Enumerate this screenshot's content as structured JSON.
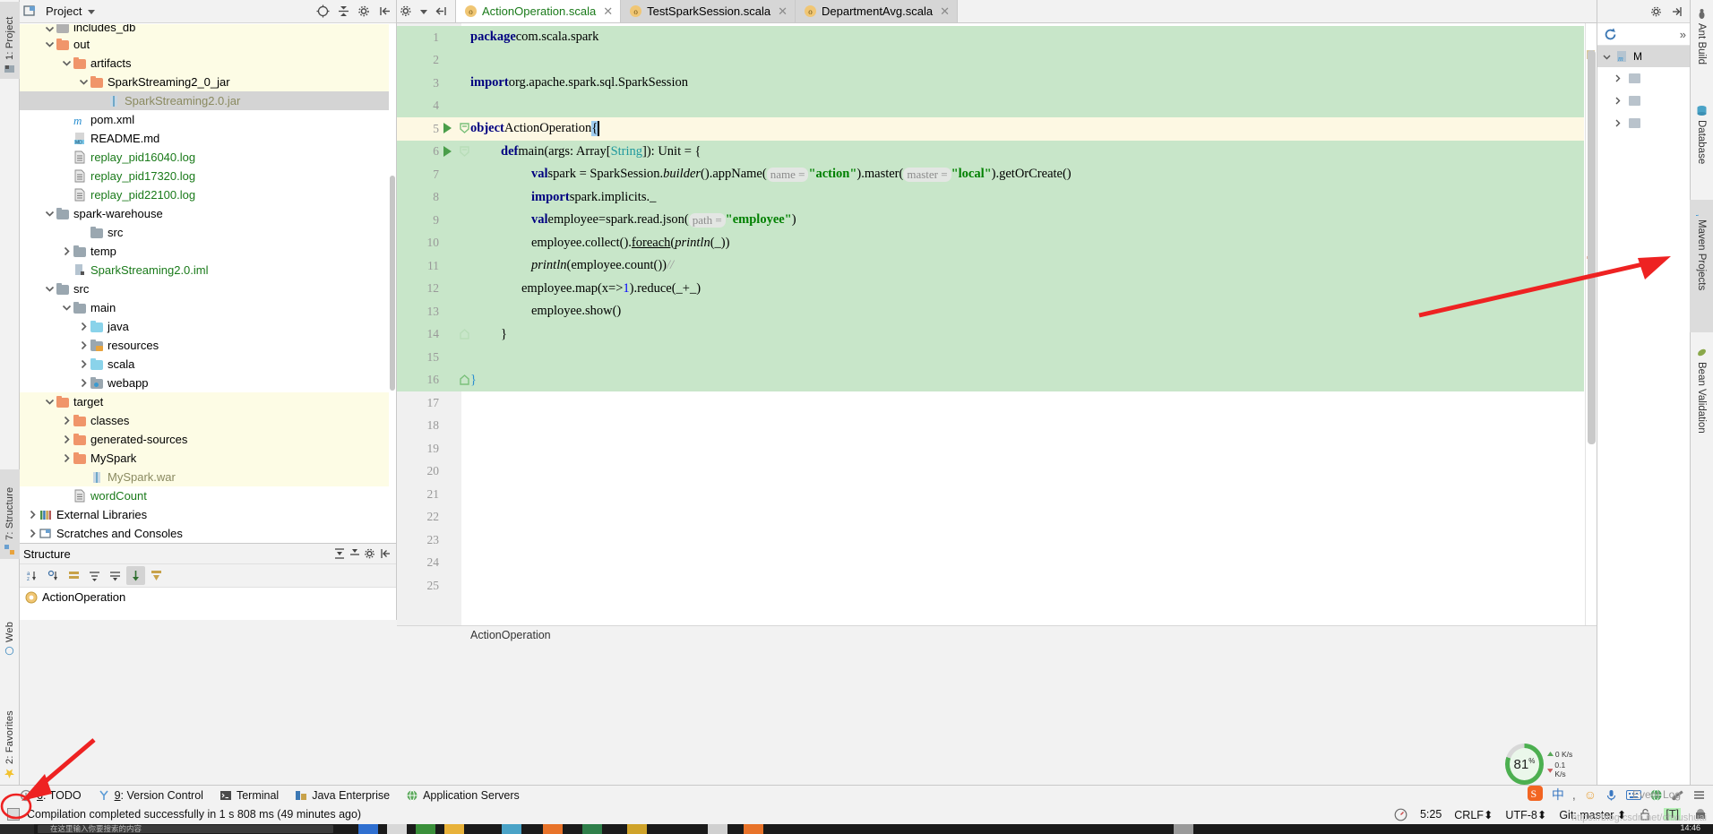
{
  "window": {
    "app": "IntelliJ IDEA"
  },
  "left_strip": {
    "tabs": [
      {
        "label": "1: Project",
        "icon": "project-icon",
        "selected": true
      },
      {
        "label": "7: Structure",
        "icon": "structure-icon",
        "selected": true
      },
      {
        "label": "Web",
        "icon": "web-icon",
        "selected": false
      },
      {
        "label": "2: Favorites",
        "icon": "favorites-icon",
        "selected": false
      }
    ]
  },
  "project_panel": {
    "title": "Project",
    "header_icons": [
      "locate-icon",
      "collapse-all-icon",
      "settings-icon",
      "hide-icon"
    ],
    "tree": [
      {
        "label": "includes_db",
        "indent": 1,
        "arrow": "down",
        "icon": "folder",
        "color": "#b0b0b0",
        "state": "excluded",
        "cut": true
      },
      {
        "label": "out",
        "indent": 1,
        "arrow": "down",
        "icon": "folder",
        "color": "#f0956a",
        "state": "excluded"
      },
      {
        "label": "artifacts",
        "indent": 2,
        "arrow": "down",
        "icon": "folder",
        "color": "#f0956a",
        "state": "excluded"
      },
      {
        "label": "SparkStreaming2_0_jar",
        "indent": 3,
        "arrow": "down",
        "icon": "folder",
        "color": "#f0956a",
        "state": "excluded"
      },
      {
        "label": "SparkStreaming2.0.jar",
        "indent": 4,
        "arrow": "none",
        "icon": "jar-icon",
        "state": "selected",
        "text_color": "#8a8a60"
      },
      {
        "label": "pom.xml",
        "indent": 2,
        "arrow": "none",
        "icon": "maven-icon",
        "state": "normal"
      },
      {
        "label": "README.md",
        "indent": 2,
        "arrow": "none",
        "icon": "markdown-icon",
        "state": "normal"
      },
      {
        "label": "replay_pid16040.log",
        "indent": 2,
        "arrow": "none",
        "icon": "file-icon",
        "state": "normal",
        "text_color": "#1a7a1a"
      },
      {
        "label": "replay_pid17320.log",
        "indent": 2,
        "arrow": "none",
        "icon": "file-icon",
        "state": "normal",
        "text_color": "#1a7a1a"
      },
      {
        "label": "replay_pid22100.log",
        "indent": 2,
        "arrow": "none",
        "icon": "file-icon",
        "state": "normal",
        "text_color": "#1a7a1a"
      },
      {
        "label": "spark-warehouse",
        "indent": 1,
        "arrow": "down",
        "icon": "folder",
        "color": "#9aa7b0",
        "state": "normal"
      },
      {
        "label": "src",
        "indent": 3,
        "arrow": "none",
        "icon": "folder",
        "color": "#9aa7b0",
        "state": "normal"
      },
      {
        "label": "temp",
        "indent": 2,
        "arrow": "right",
        "icon": "folder",
        "color": "#9aa7b0",
        "state": "normal"
      },
      {
        "label": "SparkStreaming2.0.iml",
        "indent": 2,
        "arrow": "none",
        "icon": "iml-icon",
        "state": "normal",
        "text_color": "#1a7a1a"
      },
      {
        "label": "src",
        "indent": 1,
        "arrow": "down",
        "icon": "folder",
        "color": "#9aa7b0",
        "state": "normal"
      },
      {
        "label": "main",
        "indent": 2,
        "arrow": "down",
        "icon": "folder",
        "color": "#9aa7b0",
        "state": "normal"
      },
      {
        "label": "java",
        "indent": 3,
        "arrow": "right",
        "icon": "folder",
        "color": "#8ad3ea",
        "state": "normal"
      },
      {
        "label": "resources",
        "indent": 3,
        "arrow": "right",
        "icon": "folder-res",
        "color": "#9aa7b0",
        "state": "normal"
      },
      {
        "label": "scala",
        "indent": 3,
        "arrow": "right",
        "icon": "folder",
        "color": "#8ad3ea",
        "state": "normal"
      },
      {
        "label": "webapp",
        "indent": 3,
        "arrow": "right",
        "icon": "folder-web",
        "color": "#9aa7b0",
        "state": "normal"
      },
      {
        "label": "target",
        "indent": 1,
        "arrow": "down",
        "icon": "folder",
        "color": "#f0956a",
        "state": "excluded"
      },
      {
        "label": "classes",
        "indent": 2,
        "arrow": "right",
        "icon": "folder",
        "color": "#f0956a",
        "state": "excluded"
      },
      {
        "label": "generated-sources",
        "indent": 2,
        "arrow": "right",
        "icon": "folder",
        "color": "#f0956a",
        "state": "excluded"
      },
      {
        "label": "MySpark",
        "indent": 2,
        "arrow": "right",
        "icon": "folder",
        "color": "#f0956a",
        "state": "excluded"
      },
      {
        "label": "MySpark.war",
        "indent": 3,
        "arrow": "none",
        "icon": "jar-icon",
        "state": "excluded",
        "text_color": "#8a8a60"
      },
      {
        "label": "wordCount",
        "indent": 2,
        "arrow": "none",
        "icon": "file-icon",
        "state": "normal",
        "text_color": "#1a7a1a"
      },
      {
        "label": "External Libraries",
        "indent": 0,
        "arrow": "right",
        "icon": "libraries-icon",
        "state": "normal"
      },
      {
        "label": "Scratches and Consoles",
        "indent": 0,
        "arrow": "right",
        "icon": "scratches-icon",
        "state": "normal"
      }
    ]
  },
  "structure_panel": {
    "title": "Structure",
    "header_icons": [
      "expand-icon",
      "collapse-icon",
      "settings-icon",
      "hide-icon"
    ],
    "toolbar_icons": [
      "sort-alpha-icon",
      "sort-visibility-icon",
      "group-icon",
      "show-fields-icon",
      "show-properties-icon",
      "show-inherited-icon",
      "autoscroll-from-icon",
      "autoscroll-to-icon"
    ],
    "item": {
      "label": "ActionOperation",
      "icon": "scala-object-icon"
    }
  },
  "editor": {
    "toolbar_icons": [
      "settings-icon",
      "hide-toolwindow-icon"
    ],
    "tabs": [
      {
        "label": "ActionOperation.scala",
        "active": true,
        "icon": "scala-file-icon",
        "text_color": "#1a7a1a"
      },
      {
        "label": "TestSparkSession.scala",
        "active": false,
        "icon": "scala-file-icon",
        "text_color": "#333333"
      },
      {
        "label": "DepartmentAvg.scala",
        "active": false,
        "icon": "scala-file-icon",
        "text_color": "#333333"
      }
    ],
    "breadcrumb": "ActionOperation",
    "lines": [
      {
        "n": "1",
        "bg": "green",
        "run": false,
        "fold": "none"
      },
      {
        "n": "2",
        "bg": "green",
        "run": false,
        "fold": "none"
      },
      {
        "n": "3",
        "bg": "green",
        "run": false,
        "fold": "none"
      },
      {
        "n": "4",
        "bg": "green",
        "run": false,
        "fold": "none"
      },
      {
        "n": "5",
        "bg": "caret",
        "run": true,
        "fold": "open"
      },
      {
        "n": "6",
        "bg": "green",
        "run": true,
        "fold": "open-light"
      },
      {
        "n": "7",
        "bg": "green",
        "run": false,
        "fold": "none"
      },
      {
        "n": "8",
        "bg": "green",
        "run": false,
        "fold": "none"
      },
      {
        "n": "9",
        "bg": "green",
        "run": false,
        "fold": "none"
      },
      {
        "n": "10",
        "bg": "green",
        "run": false,
        "fold": "none"
      },
      {
        "n": "11",
        "bg": "green",
        "run": false,
        "fold": "none"
      },
      {
        "n": "12",
        "bg": "green",
        "run": false,
        "fold": "none"
      },
      {
        "n": "13",
        "bg": "green",
        "run": false,
        "fold": "none"
      },
      {
        "n": "14",
        "bg": "green",
        "run": false,
        "fold": "close-light"
      },
      {
        "n": "15",
        "bg": "green",
        "run": false,
        "fold": "none"
      },
      {
        "n": "16",
        "bg": "green",
        "run": false,
        "fold": "close"
      },
      {
        "n": "17",
        "bg": "none",
        "run": false,
        "fold": "none"
      },
      {
        "n": "18",
        "bg": "none",
        "run": false,
        "fold": "none"
      },
      {
        "n": "19",
        "bg": "none",
        "run": false,
        "fold": "none"
      },
      {
        "n": "20",
        "bg": "none",
        "run": false,
        "fold": "none"
      },
      {
        "n": "21",
        "bg": "none",
        "run": false,
        "fold": "none"
      },
      {
        "n": "22",
        "bg": "none",
        "run": false,
        "fold": "none"
      },
      {
        "n": "23",
        "bg": "none",
        "run": false,
        "fold": "none"
      },
      {
        "n": "24",
        "bg": "none",
        "run": false,
        "fold": "none"
      },
      {
        "n": "25",
        "bg": "none",
        "run": false,
        "fold": "none"
      }
    ],
    "code_text": {
      "l1": "package com.scala.spark",
      "l3": "import org.apache.spark.sql.SparkSession",
      "l5": "object ActionOperation {",
      "l6": "def main(args: Array[String]): Unit = {",
      "l7": "val spark = SparkSession.builder().appName( name = \"action\").master( master = \"local\").getOrCreate()",
      "l8": "import spark.implicits._",
      "l9": "val employee=spark.read.json( path = \"employee\")",
      "l10": "employee.collect().foreach(println(_))",
      "l11": "println(employee.count())//",
      "l12": "employee.map(x=>1).reduce(_+_)",
      "l13": "employee.show()",
      "l14": "}",
      "l16": "}"
    }
  },
  "right_panel": {
    "header_icons": [
      "settings-icon",
      "hide-icon"
    ],
    "refresh_icon": "refresh-icon",
    "more_icon": "more-icon",
    "maven_label": "M",
    "rows": 3
  },
  "right_strip": {
    "tabs": [
      {
        "label": "Ant Build",
        "icon": "ant-icon",
        "selected": false
      },
      {
        "label": "Database",
        "icon": "database-icon",
        "selected": false
      },
      {
        "label": "Maven Projects",
        "icon": "maven-icon",
        "selected": true
      },
      {
        "label": "Bean Validation",
        "icon": "bean-icon",
        "selected": false
      }
    ]
  },
  "bottom_strip": {
    "tabs": [
      {
        "num": "6",
        "label": "TODO",
        "icon": "todo-icon"
      },
      {
        "num": "9",
        "label": "Version Control",
        "icon": "vcs-icon"
      },
      {
        "num": "",
        "label": "Terminal",
        "icon": "terminal-icon"
      },
      {
        "num": "",
        "label": "Java Enterprise",
        "icon": "java-ee-icon"
      },
      {
        "num": "",
        "label": "Application Servers",
        "icon": "app-servers-icon"
      }
    ],
    "event_log": "Event Log"
  },
  "status_bar": {
    "message": "Compilation completed successfully in 1 s 808 ms (49 minutes ago)",
    "caret_position": "5:25",
    "line_separator": "CRLF",
    "encoding": "UTF-8",
    "branch": "Git: master",
    "lock_icon": "unlocked-icon",
    "text_mode": "[T]",
    "inspector_icon": "inspector-icon"
  },
  "perf_widget": {
    "cpu_percent": "81",
    "cpu_unit": "%",
    "net_up": "0 K/s",
    "net_down": "0.1 K/s"
  },
  "tray": {
    "icons": [
      "sogou-icon",
      "chinese-input-icon",
      "comma-icon",
      "smiley-icon",
      "mic-icon",
      "keyboard-icon",
      "globe-icon",
      "tools-icon",
      "menu-icon"
    ],
    "ime_label": "中"
  },
  "taskbar": {
    "clock": "14:46",
    "hint": "在这里输入你要搜索的内容"
  },
  "watermark": "https://blog.csdn.net/chxushuai",
  "annotations": {
    "arrow1": "red-arrow-pointing-to-maven-projects",
    "arrow2": "red-arrow-pointing-to-status-bar-message",
    "ellipse": "red-ellipse-around-status-icon"
  },
  "colors": {
    "vcs_modified_bg": "#c8e6c9",
    "caret_line_bg": "#fdf8e3",
    "excluded_bg": "#fdfce5",
    "selection_bg": "#d4d4d4",
    "annotation_red": "#ee2222",
    "keyword": "#000080",
    "string": "#008000",
    "type": "#20999d"
  }
}
